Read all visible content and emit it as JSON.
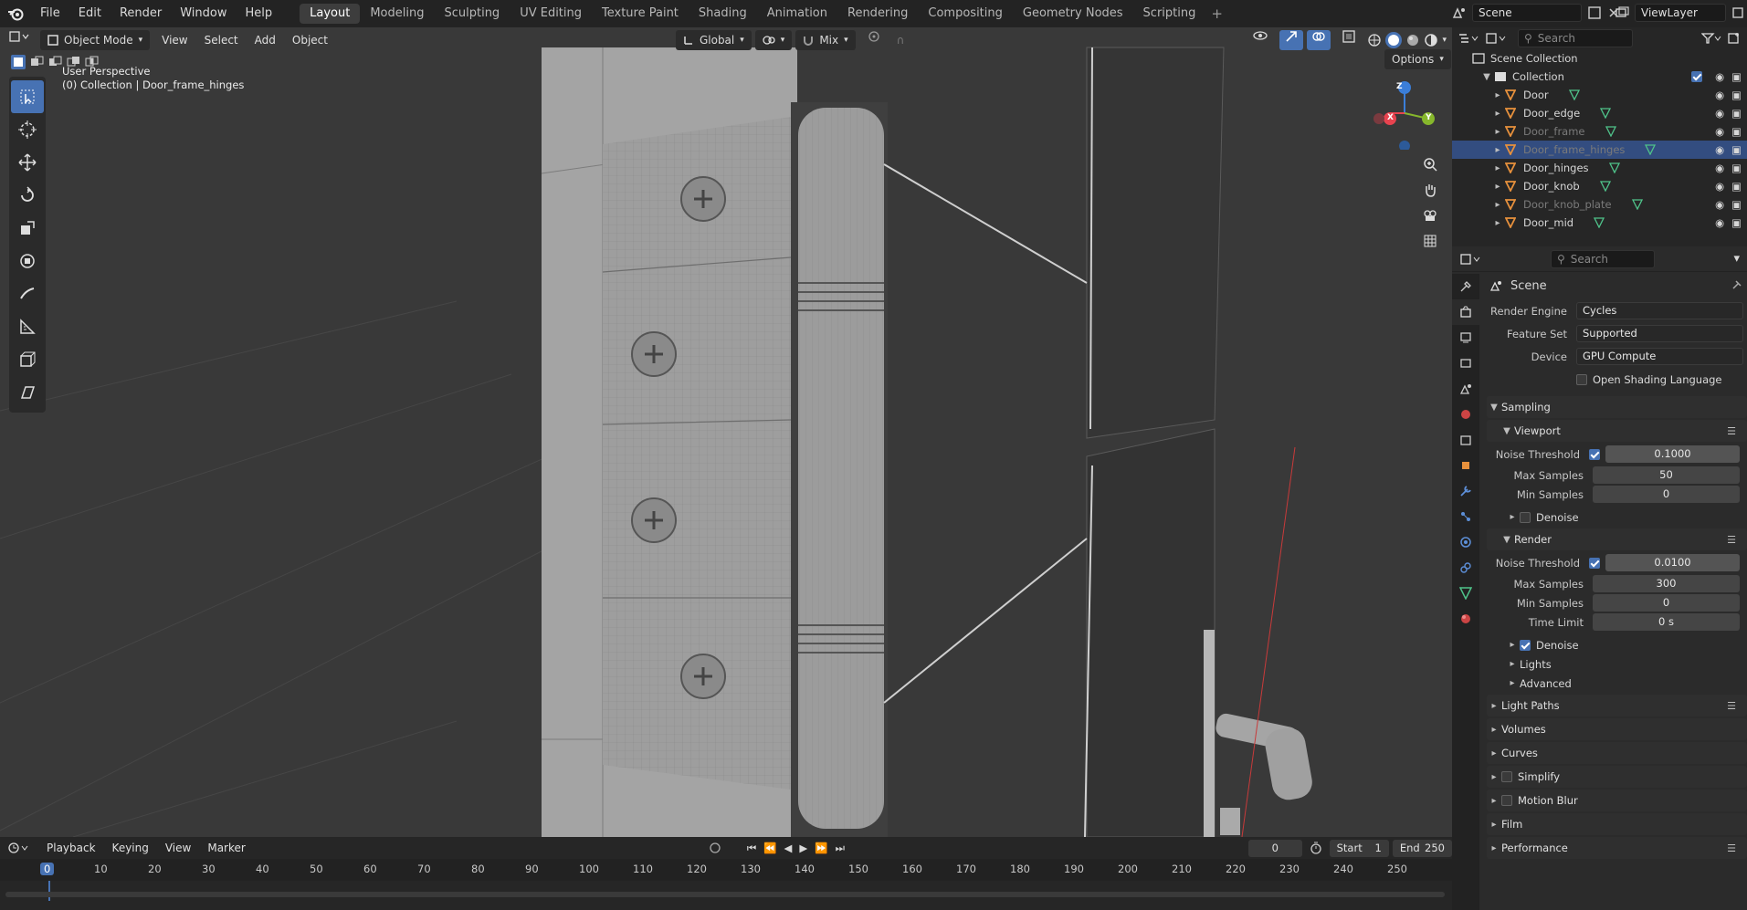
{
  "topbar": {
    "menu": [
      "File",
      "Edit",
      "Render",
      "Window",
      "Help"
    ],
    "workspaces": [
      "Layout",
      "Modeling",
      "Sculpting",
      "UV Editing",
      "Texture Paint",
      "Shading",
      "Animation",
      "Rendering",
      "Compositing",
      "Geometry Nodes",
      "Scripting"
    ],
    "active_workspace": "Layout",
    "scene_name": "Scene",
    "view_layer": "ViewLayer"
  },
  "viewport": {
    "mode": "Object Mode",
    "menus": [
      "View",
      "Select",
      "Add",
      "Object"
    ],
    "transform_orientation": "Global",
    "snap_mode": "Mix",
    "options_label": "Options",
    "overlay_line1": "User Perspective",
    "overlay_line2": "(0) Collection | Door_frame_hinges",
    "gizmo_axes": {
      "x": "X",
      "y": "Y",
      "z": "Z"
    },
    "colors": {
      "x_axis": "#e8434f",
      "y_axis": "#86b72c",
      "z_axis": "#3b7ed8",
      "selection": "#4772b3"
    }
  },
  "outliner": {
    "search_placeholder": "Search",
    "scene_collection": "Scene Collection",
    "collection": "Collection",
    "items": [
      {
        "name": "Door",
        "dim": false,
        "selected": false
      },
      {
        "name": "Door_edge",
        "dim": false,
        "selected": false
      },
      {
        "name": "Door_frame",
        "dim": true,
        "selected": false
      },
      {
        "name": "Door_frame_hinges",
        "dim": true,
        "selected": true
      },
      {
        "name": "Door_hinges",
        "dim": false,
        "selected": false
      },
      {
        "name": "Door_knob",
        "dim": false,
        "selected": false
      },
      {
        "name": "Door_knob_plate",
        "dim": true,
        "selected": false
      },
      {
        "name": "Door_mid",
        "dim": false,
        "selected": false
      }
    ]
  },
  "properties": {
    "search_placeholder": "Search",
    "context": "Scene",
    "render_engine_label": "Render Engine",
    "render_engine": "Cycles",
    "feature_set_label": "Feature Set",
    "feature_set": "Supported",
    "device_label": "Device",
    "device": "GPU Compute",
    "osl_label": "Open Shading Language",
    "sampling": "Sampling",
    "viewport": {
      "title": "Viewport",
      "noise_threshold_label": "Noise Threshold",
      "noise_threshold": "0.1000",
      "max_samples_label": "Max Samples",
      "max_samples": "50",
      "min_samples_label": "Min Samples",
      "min_samples": "0",
      "denoise_label": "Denoise"
    },
    "render": {
      "title": "Render",
      "noise_threshold_label": "Noise Threshold",
      "noise_threshold": "0.0100",
      "max_samples_label": "Max Samples",
      "max_samples": "300",
      "min_samples_label": "Min Samples",
      "min_samples": "0",
      "time_limit_label": "Time Limit",
      "time_limit": "0 s",
      "denoise_label": "Denoise"
    },
    "lights": "Lights",
    "advanced": "Advanced",
    "panels": [
      "Light Paths",
      "Volumes",
      "Curves",
      "Simplify",
      "Motion Blur",
      "Film",
      "Performance"
    ]
  },
  "timeline": {
    "menus": [
      "Playback",
      "Keying",
      "View",
      "Marker"
    ],
    "current_frame": "0",
    "start_label": "Start",
    "start": "1",
    "end_label": "End",
    "end": "250",
    "ruler": [
      "0",
      "10",
      "20",
      "30",
      "40",
      "50",
      "60",
      "70",
      "80",
      "90",
      "100",
      "110",
      "120",
      "130",
      "140",
      "150",
      "160",
      "170",
      "180",
      "190",
      "200",
      "210",
      "220",
      "230",
      "240",
      "250"
    ]
  }
}
